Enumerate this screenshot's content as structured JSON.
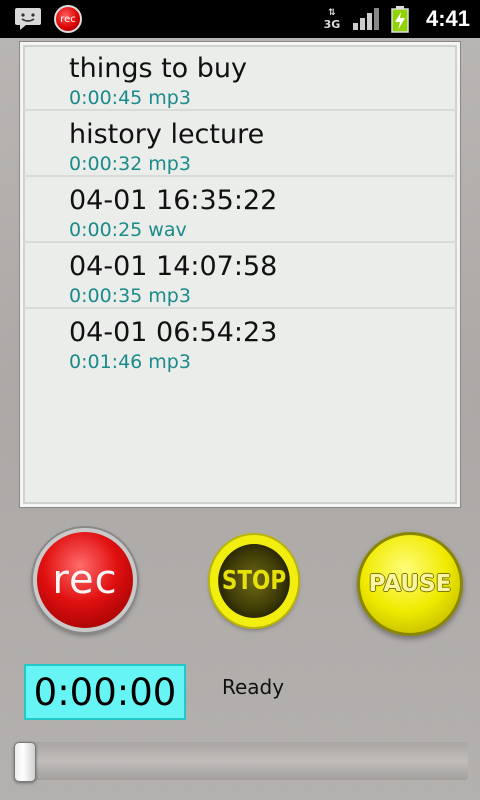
{
  "status_bar": {
    "notification_rec": "rec",
    "network": "3G",
    "clock": "4:41"
  },
  "recordings": [
    {
      "title": "things to buy",
      "meta": "0:00:45 mp3"
    },
    {
      "title": "history lecture",
      "meta": "0:00:32 mp3"
    },
    {
      "title": "04-01 16:35:22",
      "meta": "0:00:25 wav"
    },
    {
      "title": "04-01 14:07:58",
      "meta": "0:00:35 mp3"
    },
    {
      "title": "04-01 06:54:23",
      "meta": "0:01:46 mp3"
    }
  ],
  "controls": {
    "rec_label": "rec",
    "stop_label": "STOP",
    "pause_label": "PAUSE"
  },
  "timer": "0:00:00",
  "status": "Ready",
  "seek_position": 0,
  "colors": {
    "timer_bg": "#66f4f4",
    "meta_text": "#1a8a8a",
    "rec_red": "#e01010",
    "stop_yellow": "#f2ee10",
    "pause_yellow": "#f0ea00"
  }
}
